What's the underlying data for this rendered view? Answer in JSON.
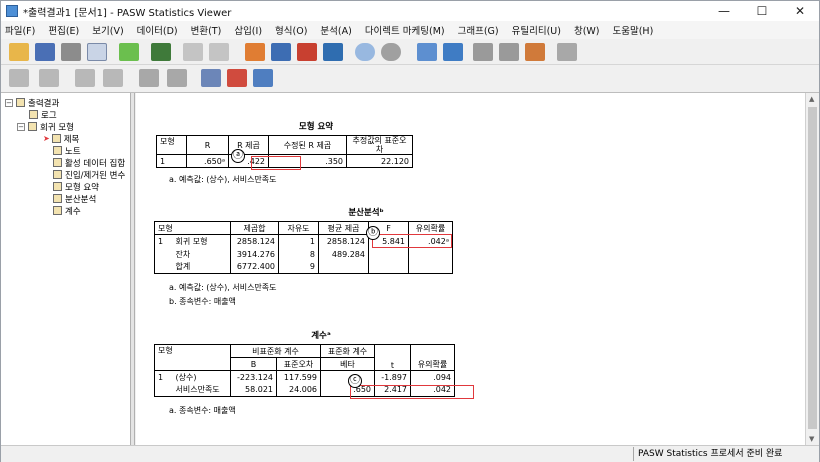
{
  "window": {
    "title": "*출력결과1 [문서1] - PASW Statistics Viewer"
  },
  "menu": [
    "파일(F)",
    "편집(E)",
    "보기(V)",
    "데이터(D)",
    "변환(T)",
    "삽입(I)",
    "형식(O)",
    "분석(A)",
    "다이렉트 마케팅(M)",
    "그래프(G)",
    "유틸리티(U)",
    "창(W)",
    "도움말(H)"
  ],
  "toolbar_icons": [
    "open-icon",
    "save-icon",
    "print-icon",
    "preview-icon",
    "export-icon",
    "goto-data-icon",
    "undo-icon",
    "redo-icon",
    "goto-case-icon",
    "variables-icon",
    "select-cases-icon",
    "weight-icon",
    "split-icon",
    "value-labels-icon",
    "use-sets-icon",
    "show-all-icon",
    "designate-window-icon",
    "insert-output-icon",
    "promote-icon",
    "demote-icon",
    "expand-icon",
    "collapse-icon",
    "show-icon",
    "hide-icon",
    "insert-heading-icon",
    "insert-title-icon",
    "insert-text-icon",
    "stop-icon"
  ],
  "nav": {
    "items": [
      {
        "label": "출력결과"
      },
      {
        "label": "로그"
      },
      {
        "label": "회귀 모형"
      },
      {
        "label": "제목"
      },
      {
        "label": "노트"
      },
      {
        "label": "활성 데이터 집합"
      },
      {
        "label": "진입/제거된 변수"
      },
      {
        "label": "모형 요약"
      },
      {
        "label": "분산분석"
      },
      {
        "label": "계수"
      }
    ]
  },
  "model_summary": {
    "title": "모형 요약",
    "headers": [
      "모형",
      "R",
      "R 제곱",
      "수정된 R 제곱",
      "추정값의 표준오차"
    ],
    "row": [
      "1",
      ".650ᵃ",
      ".422",
      ".350",
      "22.120"
    ],
    "note_a": "a. 예측값: (상수), 서비스만족도"
  },
  "anova": {
    "title": "분산분석ᵇ",
    "headers": [
      "모형",
      "",
      "제곱합",
      "자유도",
      "평균 제곱",
      "F",
      "유의확률"
    ],
    "rows": [
      [
        "1",
        "회귀 모형",
        "2858.124",
        "1",
        "2858.124",
        "5.841",
        ".042ᵃ"
      ],
      [
        "",
        "잔차",
        "3914.276",
        "8",
        "489.284",
        "",
        ""
      ],
      [
        "",
        "합계",
        "6772.400",
        "9",
        "",
        "",
        ""
      ]
    ],
    "note_a": "a. 예측값: (상수), 서비스만족도",
    "note_b": "b. 종속변수: 매출액"
  },
  "coefficients": {
    "title": "계수ᵃ",
    "group_headers": [
      "모형",
      "비표준화 계수",
      "표준화 계수",
      "t",
      "유의확률"
    ],
    "sub_headers": [
      "B",
      "표준오차",
      "베타"
    ],
    "rows": [
      [
        "1",
        "(상수)",
        "-223.124",
        "117.599",
        "",
        "-1.897",
        ".094"
      ],
      [
        "",
        "서비스만족도",
        "58.021",
        "24.006",
        ".650",
        "2.417",
        ".042"
      ]
    ],
    "note_a": "a. 종속변수: 매출액"
  },
  "markers": {
    "a": "ⓐ",
    "b": "ⓑ",
    "c": "ⓒ"
  },
  "status": {
    "text": "PASW Statistics 프로세서 준비 완료"
  },
  "colors": {
    "accent": "#e0383c",
    "nav_bg": "#ffffff",
    "bar_bg": "#f0f0f0"
  }
}
